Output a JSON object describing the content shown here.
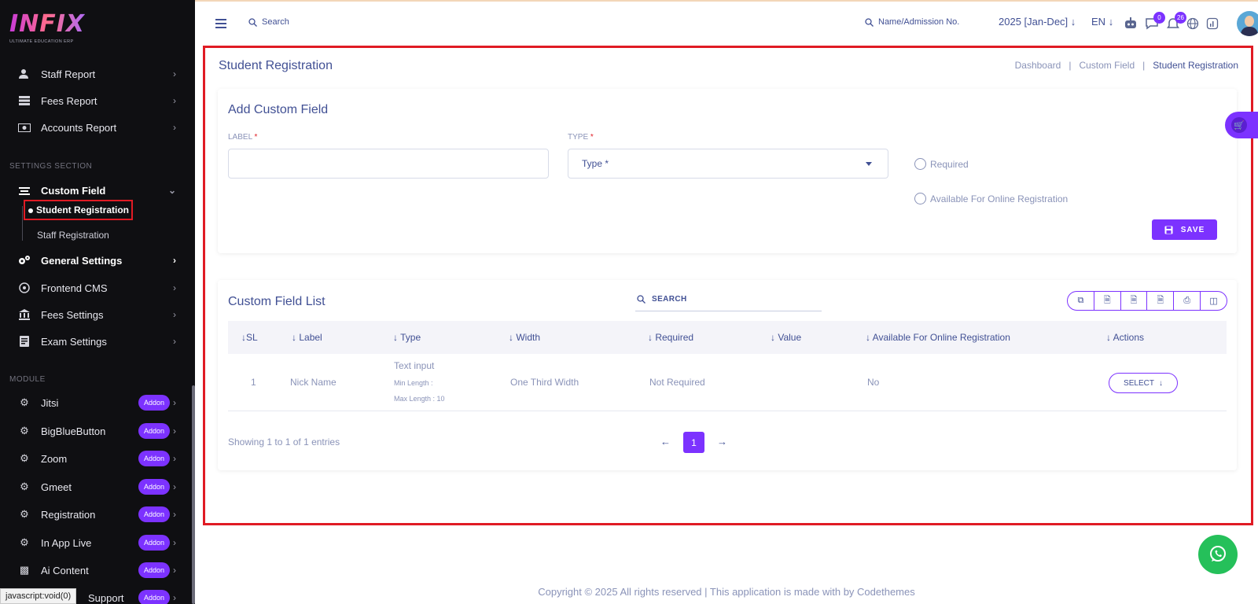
{
  "brand": {
    "logo": "INFIX",
    "tagline": "ULTIMATE EDUCATION ERP"
  },
  "sidebar": {
    "items_top": [
      {
        "label": "Staff Report",
        "icon": "user-report-icon"
      },
      {
        "label": "Fees Report",
        "icon": "fees-report-icon"
      },
      {
        "label": "Accounts Report",
        "icon": "accounts-report-icon"
      }
    ],
    "settings_section_label": "SETTINGS SECTION",
    "custom_field": {
      "label": "Custom Field",
      "icon": "custom-field-icon"
    },
    "sub_items": {
      "active": "Student Registration",
      "other": "Staff Registration"
    },
    "settings_items": [
      {
        "label": "General Settings",
        "icon": "gears-icon"
      },
      {
        "label": "Frontend CMS",
        "icon": "cms-icon"
      },
      {
        "label": "Fees Settings",
        "icon": "bank-icon"
      },
      {
        "label": "Exam Settings",
        "icon": "exam-icon"
      }
    ],
    "module_label": "MODULE",
    "modules": [
      {
        "label": "Jitsi",
        "badge": "Addon"
      },
      {
        "label": "BigBlueButton",
        "badge": "Addon"
      },
      {
        "label": "Zoom",
        "badge": "Addon"
      },
      {
        "label": "Gmeet",
        "badge": "Addon"
      },
      {
        "label": "Registration",
        "badge": "Addon"
      },
      {
        "label": "In App Live",
        "badge": "Addon"
      },
      {
        "label": "Ai Content",
        "badge": "Addon"
      },
      {
        "label": "Support",
        "badge": "Addon"
      }
    ],
    "status_tip": "javascript:void(0)"
  },
  "header": {
    "search_placeholder": "Search",
    "student_search": "Name/Admission No.",
    "academic_year": "2025 [Jan-Dec]",
    "language": "EN",
    "chat_count": "0",
    "notification_count": "26"
  },
  "page": {
    "title": "Student Registration",
    "breadcrumb": [
      "Dashboard",
      "Custom Field",
      "Student Registration"
    ]
  },
  "form": {
    "title": "Add Custom Field",
    "label_field": "LABEL",
    "type_field": "TYPE",
    "required_mark": "*",
    "label_value": "",
    "type_placeholder": "Type *",
    "required_option": "Required",
    "online_option": "Available For Online Registration",
    "save_label": "SAVE"
  },
  "list": {
    "title": "Custom Field List",
    "search_label": "SEARCH",
    "columns": [
      "SL",
      "Label",
      "Type",
      "Width",
      "Required",
      "Value",
      "Available For Online Registration",
      "Actions"
    ],
    "rows": [
      {
        "sl": "1",
        "label": "Nick Name",
        "type": "Text input",
        "min_length": "Min Length :",
        "max_length": "Max Length : 10",
        "width": "One Third Width",
        "required": "Not Required",
        "value": "",
        "online": "No",
        "action": "SELECT"
      }
    ],
    "showing": "Showing 1 to 1 of 1 entries",
    "current_page": "1"
  },
  "footer": "Copyright © 2025 All rights reserved | This application is made with by Codethemes",
  "colors": {
    "accent": "#7c32ff",
    "primary_text": "#415094",
    "highlight": "#e01b24",
    "whatsapp": "#25c05a"
  }
}
